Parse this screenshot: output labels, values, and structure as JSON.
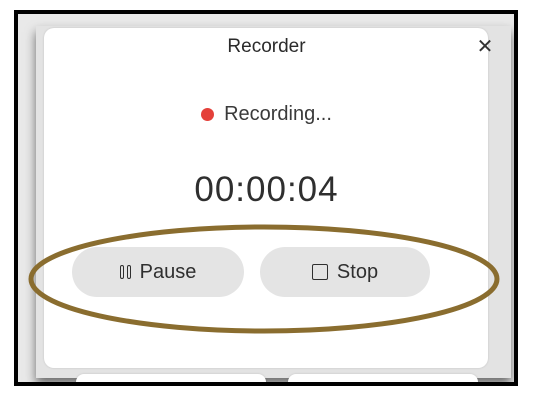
{
  "window": {
    "title": "Recorder",
    "close_icon": "close-icon"
  },
  "status": {
    "text": "Recording...",
    "indicator_color": "#e4403a"
  },
  "timer": {
    "value": "00:00:04"
  },
  "controls": {
    "pause_label": "Pause",
    "pause_icon": "pause-icon",
    "stop_label": "Stop",
    "stop_icon": "stop-icon"
  },
  "annotation": {
    "shape": "ellipse",
    "color": "#8a6d2f",
    "target": "controls"
  }
}
